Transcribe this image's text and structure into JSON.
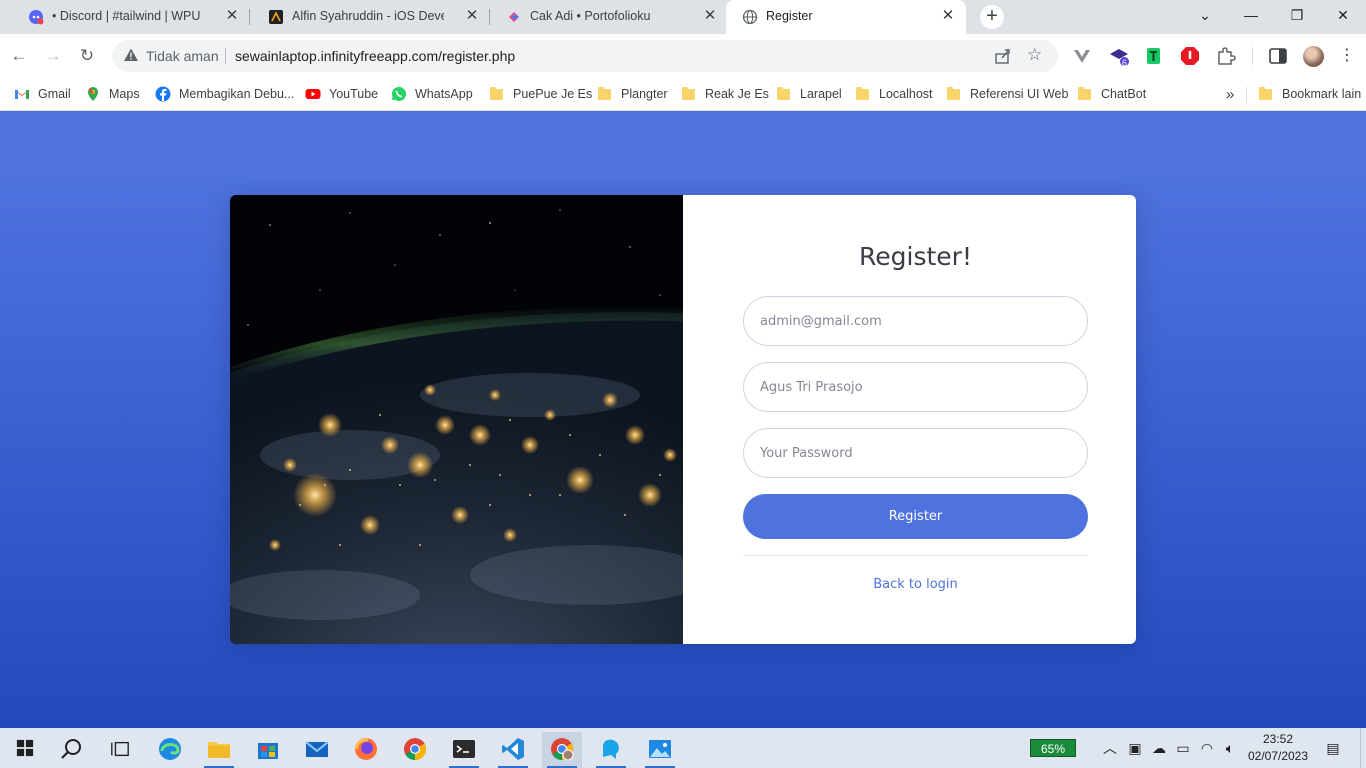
{
  "browser": {
    "tabs": [
      {
        "title": "• Discord | #tailwind | WPU",
        "icon": "discord-icon"
      },
      {
        "title": "Alfin Syahruddin - iOS Developer",
        "icon": "alfin-site-icon"
      },
      {
        "title": "Cak Adi • Portofolioku",
        "icon": "portfolio-icon"
      },
      {
        "title": "Register",
        "icon": "globe-icon",
        "active": true
      }
    ],
    "address": {
      "security_label": "Tidak aman",
      "url": "sewainlaptop.infinityfreeapp.com/register.php"
    },
    "extension_badge": "6",
    "bookmarks": [
      {
        "label": "Gmail",
        "icon": "gmail-icon"
      },
      {
        "label": "Maps",
        "icon": "maps-icon"
      },
      {
        "label": "Membagikan Debu...",
        "icon": "facebook-icon"
      },
      {
        "label": "YouTube",
        "icon": "youtube-icon"
      },
      {
        "label": "WhatsApp",
        "icon": "whatsapp-icon"
      },
      {
        "label": "PuePue Je Es",
        "icon": "folder-icon"
      },
      {
        "label": "Plangter",
        "icon": "folder-icon"
      },
      {
        "label": "Reak Je Es",
        "icon": "folder-icon"
      },
      {
        "label": "Larapel",
        "icon": "folder-icon"
      },
      {
        "label": "Localhost",
        "icon": "folder-icon"
      },
      {
        "label": "Referensi UI Web",
        "icon": "folder-icon"
      },
      {
        "label": "ChatBot",
        "icon": "folder-icon"
      }
    ],
    "more_bookmarks": "»",
    "other_bookmarks": "Bookmark lain"
  },
  "register": {
    "title": "Register!",
    "email_placeholder": "admin@gmail.com",
    "name_placeholder": "Agus Tri Prasojo",
    "password_placeholder": "Your Password",
    "submit_label": "Register",
    "back_link": "Back to login"
  },
  "taskbar": {
    "battery": "65%",
    "time": "23:52",
    "date": "02/07/2023"
  },
  "colors": {
    "primary": "#4e73df",
    "primary_dark": "#224abe",
    "card": "#ffffff"
  }
}
